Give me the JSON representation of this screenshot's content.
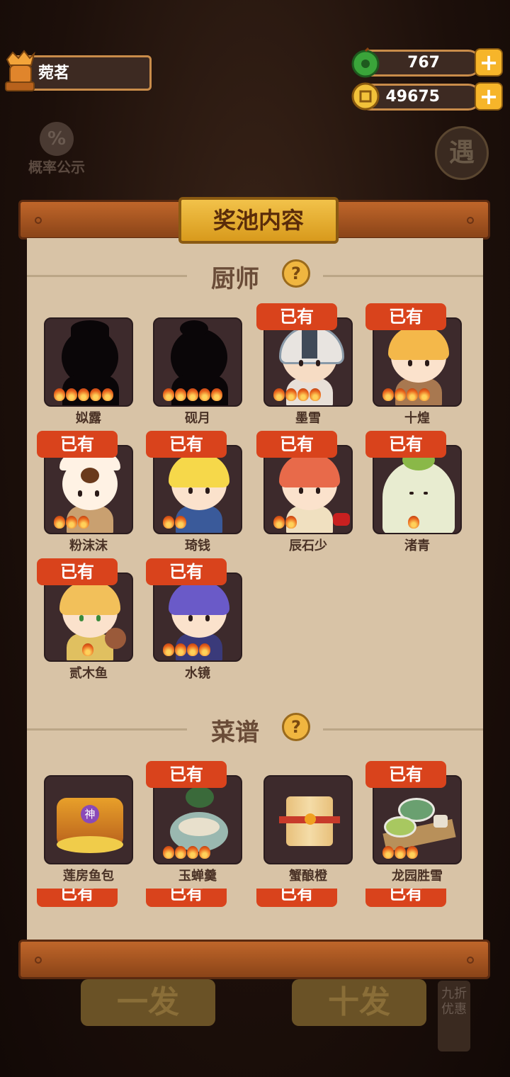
{
  "player": {
    "name": "菀茗"
  },
  "currency": {
    "jade": "767",
    "coins": "49675"
  },
  "probability": {
    "label": "概率公示",
    "icon": "%"
  },
  "right_badge": {
    "label": "遇"
  },
  "panel": {
    "title": "奖池内容"
  },
  "sections": {
    "chefs": {
      "title": "厨师"
    },
    "recipes": {
      "title": "菜谱"
    }
  },
  "owned_label": "已有",
  "chefs": [
    {
      "name": "姒露",
      "owned": false,
      "stars": 5
    },
    {
      "name": "砚月",
      "owned": false,
      "stars": 5
    },
    {
      "name": "墨雪",
      "owned": true,
      "stars": 4
    },
    {
      "name": "十煌",
      "owned": true,
      "stars": 4
    },
    {
      "name": "粉沫沫",
      "owned": true,
      "stars": 3
    },
    {
      "name": "琦钱",
      "owned": true,
      "stars": 2
    },
    {
      "name": "辰石少",
      "owned": true,
      "stars": 2
    },
    {
      "name": "渚青",
      "owned": true,
      "stars": 1
    },
    {
      "name": "贰木鱼",
      "owned": true,
      "stars": 1
    },
    {
      "name": "水镜",
      "owned": true,
      "stars": 4
    }
  ],
  "recipes": [
    {
      "name": "莲房鱼包",
      "owned": false,
      "stars": 0,
      "badge": "神"
    },
    {
      "name": "玉蝉羹",
      "owned": true,
      "stars": 4
    },
    {
      "name": "蟹酿橙",
      "owned": false,
      "stars": 0
    },
    {
      "name": "龙园胜雪",
      "owned": true,
      "stars": 3
    }
  ],
  "bottom": {
    "single": "一发",
    "ten": "十发",
    "discount": "九折优惠"
  },
  "colors": {
    "owned_badge": "#d9431c",
    "paper": "#d8c3a6",
    "card": "#3d2a2c",
    "title_plate": "#f2c24a"
  }
}
